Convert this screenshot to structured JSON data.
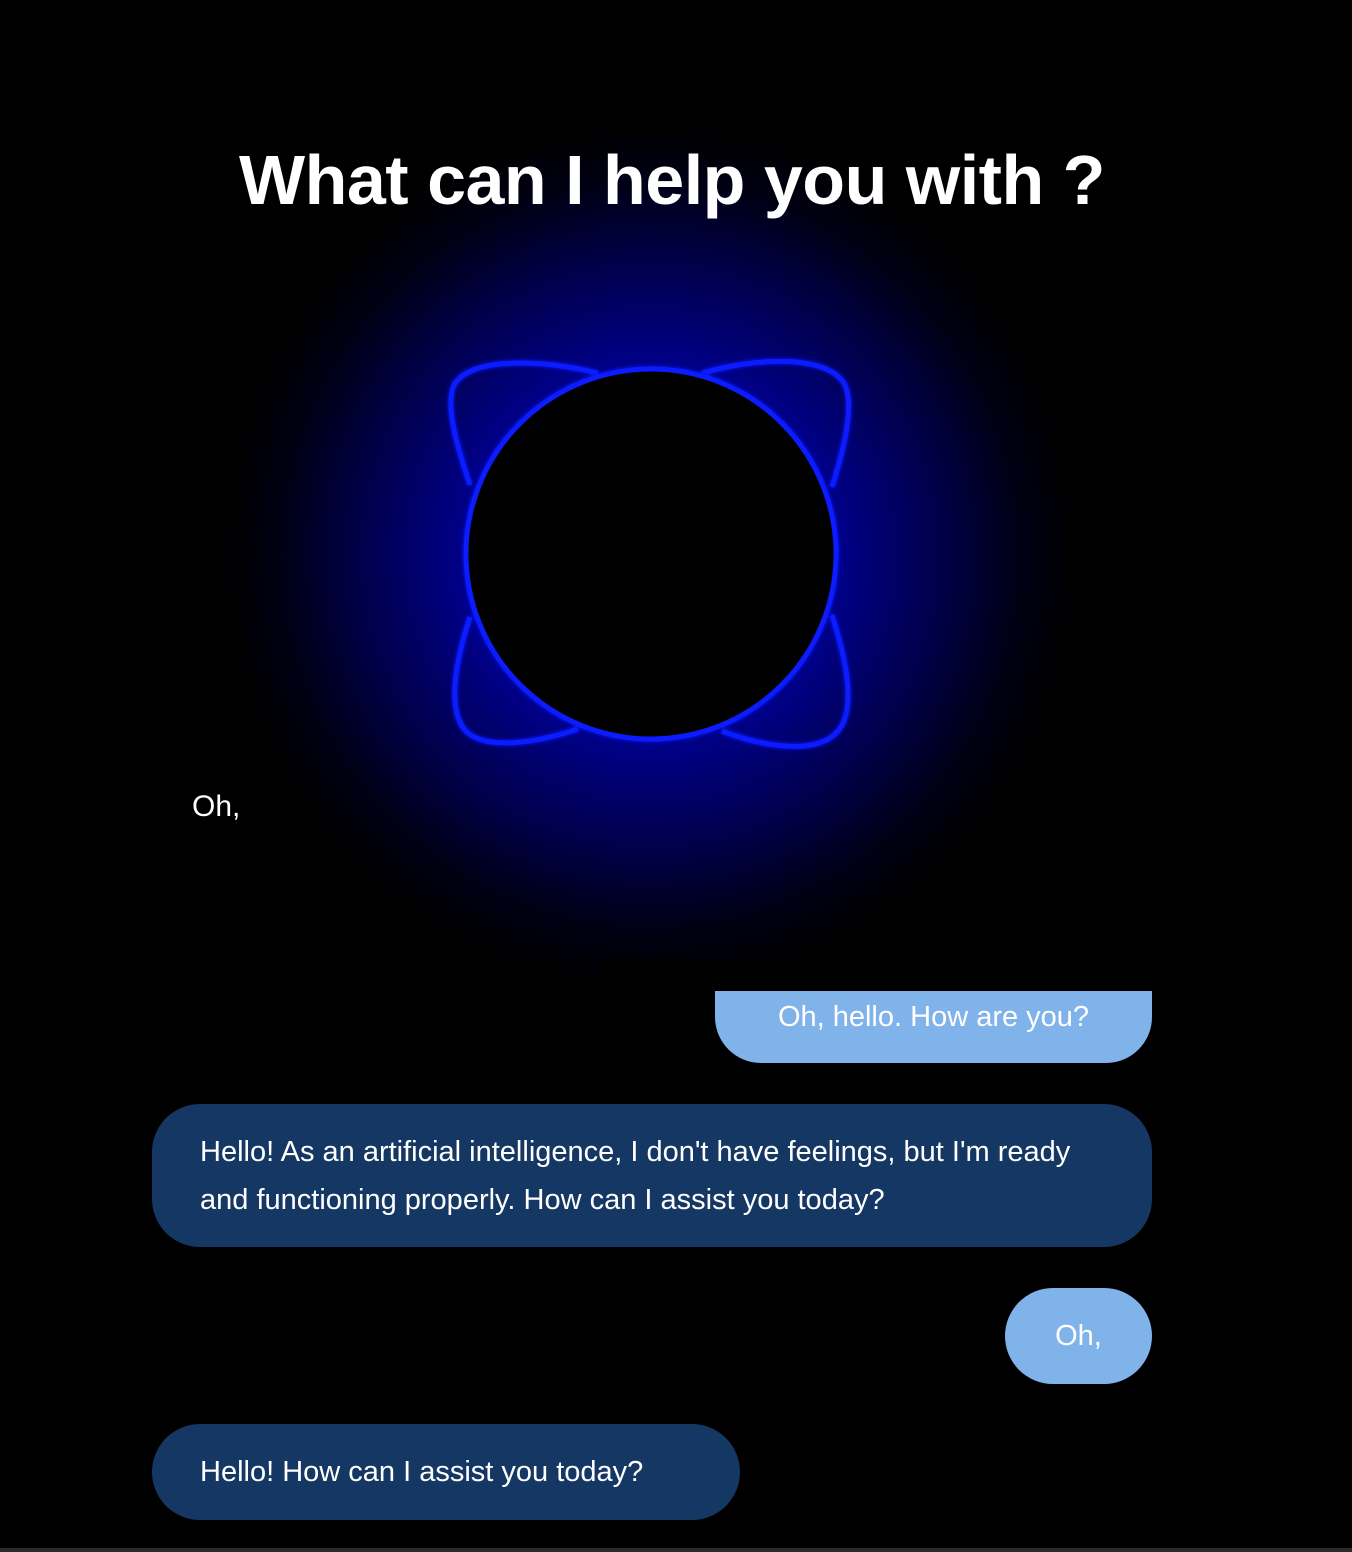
{
  "header": {
    "title": "What can I help you with ?"
  },
  "assistant_orb": {
    "icon": "voice-orb-icon",
    "colors": {
      "ring": "#0a1aff",
      "glow": "#0000aa",
      "core": "#000000"
    }
  },
  "live_transcript": {
    "text": "Oh,"
  },
  "conversation": {
    "messages": [
      {
        "role": "user",
        "text": "Oh, hello. How are you?"
      },
      {
        "role": "assistant",
        "text": "Hello! As an artificial intelligence, I don't have feelings, but I'm ready and functioning properly. How can I assist you today?"
      },
      {
        "role": "user",
        "text": "Oh,"
      },
      {
        "role": "assistant",
        "text": "Hello! How can I assist you today?"
      }
    ]
  },
  "colors": {
    "background": "#000000",
    "user_bubble": "#7fb3ea",
    "assistant_bubble": "#153763",
    "text": "#ffffff"
  }
}
